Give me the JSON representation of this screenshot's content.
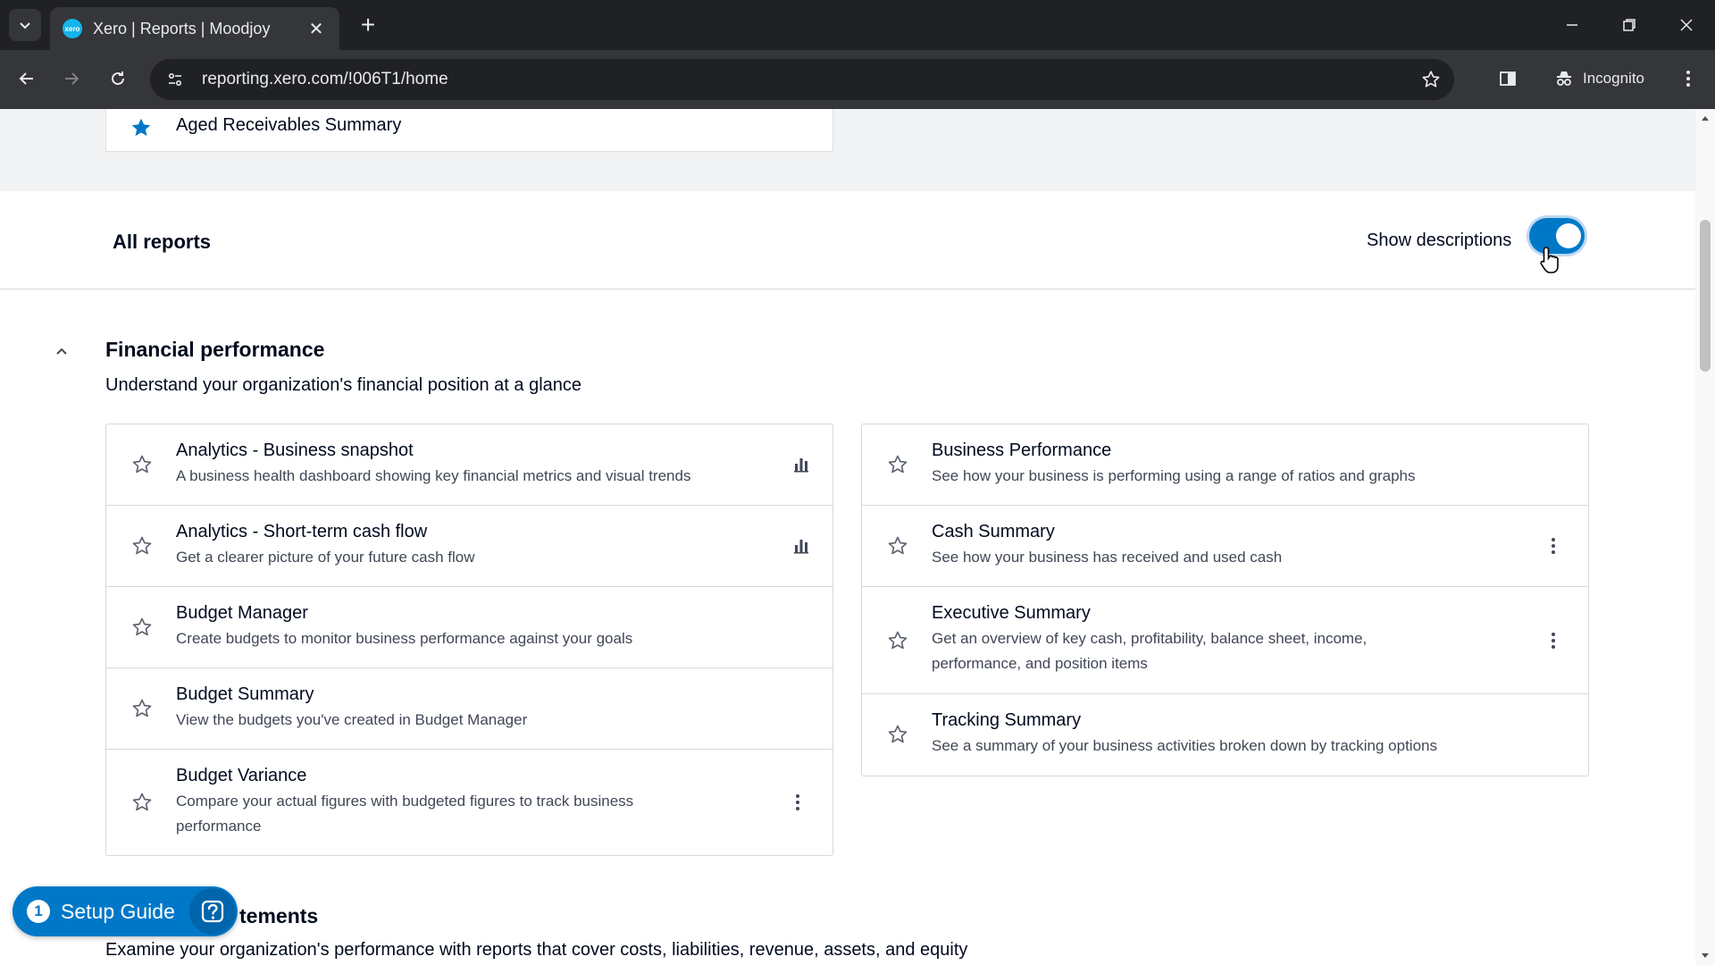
{
  "browser": {
    "tab_title": "Xero | Reports | Moodjoy",
    "favicon_text": "xero",
    "url": "reporting.xero.com/!006T1/home",
    "incognito_label": "Incognito"
  },
  "favorites": {
    "items": [
      {
        "label": "Aged Receivables Summary",
        "starred": true
      }
    ]
  },
  "all_reports": {
    "title": "All reports",
    "show_descriptions_label": "Show descriptions",
    "show_descriptions_on": true
  },
  "financial_performance": {
    "title": "Financial performance",
    "description": "Understand your organization's financial position at a glance",
    "left_reports": [
      {
        "title": "Analytics - Business snapshot",
        "description": "A business health dashboard showing key financial metrics and visual trends",
        "icon": "bar-chart-icon"
      },
      {
        "title": "Analytics - Short-term cash flow",
        "description": "Get a clearer picture of your future cash flow",
        "icon": "bar-chart-icon"
      },
      {
        "title": "Budget Manager",
        "description": "Create budgets to monitor business performance against your goals",
        "icon": ""
      },
      {
        "title": "Budget Summary",
        "description": "View the budgets you've created in Budget Manager",
        "icon": ""
      },
      {
        "title": "Budget Variance",
        "description": "Compare your actual figures with budgeted figures to track business performance",
        "icon": "more-options-icon"
      }
    ],
    "right_reports": [
      {
        "title": "Business Performance",
        "description": "See how your business is performing using a range of ratios and graphs",
        "icon": ""
      },
      {
        "title": "Cash Summary",
        "description": "See how your business has received and used cash",
        "icon": "more-options-icon"
      },
      {
        "title": "Executive Summary",
        "description": "Get an overview of key cash, profitability, balance sheet, income, performance, and position items",
        "icon": "more-options-icon"
      },
      {
        "title": "Tracking Summary",
        "description": "See a summary of your business activities broken down by tracking options",
        "icon": ""
      }
    ]
  },
  "next_section": {
    "title_visible": "tements",
    "description": "Examine your organization's performance with reports that cover costs, liabilities, revenue, assets, and equity"
  },
  "setup_guide": {
    "count": "1",
    "label": "Setup Guide"
  },
  "colors": {
    "brand_blue": "#0078c8",
    "text_primary": "#000a1e",
    "text_secondary": "#404756"
  }
}
